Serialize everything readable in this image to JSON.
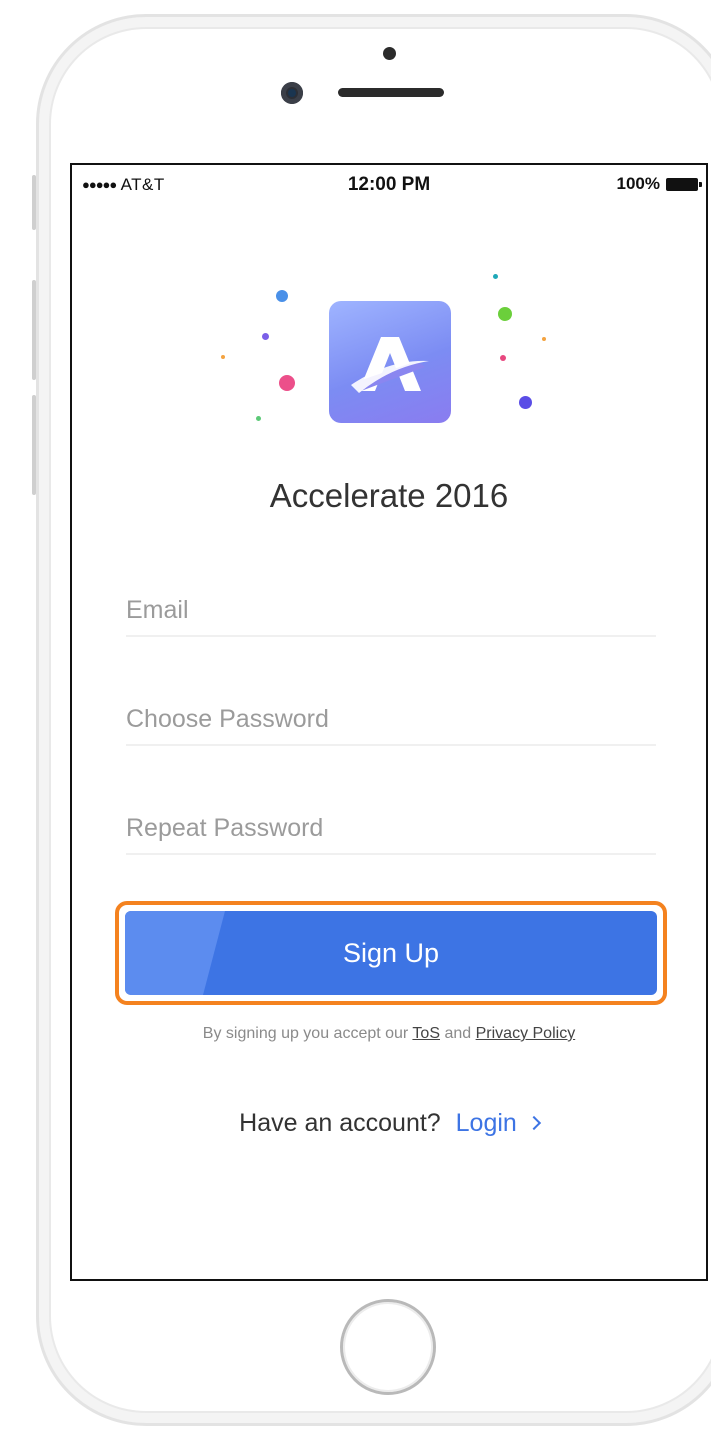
{
  "status_bar": {
    "signal_dots": "●●●●●",
    "carrier": "AT&T",
    "time": "12:00 PM",
    "battery_percent": "100%",
    "battery_icon": "battery-full-icon"
  },
  "app": {
    "logo_icon": "accelerate-logo-icon",
    "title": "Accelerate 2016",
    "accent_color": "#3d74e4",
    "highlight_color": "#f4821f"
  },
  "form": {
    "email_placeholder": "Email",
    "email_value": "",
    "password_placeholder": "Choose Password",
    "password_value": "",
    "repeat_placeholder": "Repeat Password",
    "repeat_value": "",
    "signup_label": "Sign Up"
  },
  "terms": {
    "prefix": "By signing up you accept our",
    "tos": "ToS",
    "and": "and",
    "privacy": "Privacy Policy"
  },
  "login_prompt": {
    "question": "Have an account?",
    "link": "Login",
    "chevron_icon": "chevron-right-icon"
  }
}
